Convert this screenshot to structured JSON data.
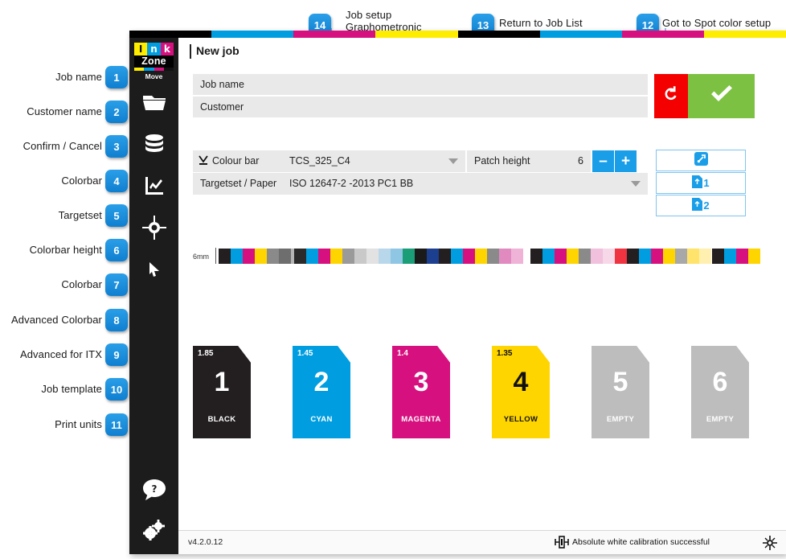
{
  "app": {
    "logo": {
      "letters": [
        "I",
        "n",
        "k"
      ],
      "word": "Zone",
      "sub": "Move"
    },
    "window_title": "New job",
    "close_label": "✖"
  },
  "form": {
    "job_name_placeholder": "Job name",
    "customer_placeholder": "Customer",
    "cancel_label": "↶",
    "confirm_label": "✔"
  },
  "options": {
    "colour_bar_label": "Colour bar",
    "colour_bar_value": "TCS_325_C4",
    "patch_height_label": "Patch height",
    "patch_height_value": "6",
    "minus_label": "–",
    "plus_label": "+",
    "targetset_label": "Targetset / Paper",
    "targetset_value": "ISO 12647-2 -2013 PC1 BB",
    "advanced_colorbar_label": "↗",
    "itx1_label": "1",
    "itx2_label": "2"
  },
  "strip": {
    "scale_label": "6mm"
  },
  "units": [
    {
      "density": "1.85",
      "number": "1",
      "name": "BLACK",
      "bg": "#231f20",
      "fg": "#ffffff"
    },
    {
      "density": "1.45",
      "number": "2",
      "name": "CYAN",
      "bg": "#009ee0",
      "fg": "#ffffff"
    },
    {
      "density": "1.4",
      "number": "3",
      "name": "MAGENTA",
      "bg": "#d6117f",
      "fg": "#ffffff"
    },
    {
      "density": "1.35",
      "number": "4",
      "name": "YELLOW",
      "bg": "#ffd500",
      "fg": "#111111"
    },
    {
      "density": "",
      "number": "5",
      "name": "EMPTY",
      "bg": "#bdbdbd",
      "fg": "#ffffff"
    },
    {
      "density": "",
      "number": "6",
      "name": "EMPTY",
      "bg": "#bdbdbd",
      "fg": "#ffffff"
    }
  ],
  "status": {
    "version": "v4.2.0.12",
    "calibration": "Absolute white calibration successful"
  },
  "sidebar": {
    "items": [
      {
        "icon": "folder-icon"
      },
      {
        "icon": "database-icon"
      },
      {
        "icon": "chart-icon"
      },
      {
        "icon": "target-icon"
      },
      {
        "icon": "cursor-icon"
      },
      {
        "icon": "help-icon"
      },
      {
        "icon": "settings-icon"
      }
    ]
  },
  "annotations": {
    "left": [
      {
        "n": "1",
        "label": "Job name"
      },
      {
        "n": "2",
        "label": "Customer name"
      },
      {
        "n": "3",
        "label": "Confirm / Cancel"
      },
      {
        "n": "4",
        "label": "Colorbar"
      },
      {
        "n": "5",
        "label": "Targetset"
      },
      {
        "n": "6",
        "label": "Colorbar height"
      },
      {
        "n": "7",
        "label": "Colorbar"
      },
      {
        "n": "8",
        "label": "Advanced Colorbar"
      },
      {
        "n": "9",
        "label": "Advanced for ITX"
      },
      {
        "n": "10",
        "label": "Job template"
      },
      {
        "n": "11",
        "label": "Print units"
      }
    ],
    "top": [
      {
        "n": "14",
        "label": "Job setup\nGraphometronic"
      },
      {
        "n": "13",
        "label": "Return to Job List"
      },
      {
        "n": "12",
        "label": "Got to Spot color setup"
      }
    ]
  },
  "colors": {
    "accent": "#1a9ee8",
    "cyan": "#009ee0",
    "magenta": "#d6117f",
    "yellow": "#ffed00",
    "black": "#000000",
    "confirm_green": "#7cc142",
    "cancel_red": "#f40000"
  },
  "cmyk_bar": [
    "#000000",
    "#009ee0",
    "#d6117f",
    "#ffed00",
    "#000000",
    "#009ee0",
    "#d6117f",
    "#ffed00"
  ],
  "strip_groups": [
    [
      "#231f20",
      "#009ee0",
      "#d6117f",
      "#ffd500",
      "#8a8a8a",
      "#6e6e6e",
      "#b5b5b5"
    ],
    [
      "#2b2b2b",
      "#009ee0",
      "#d6117f",
      "#ffd500",
      "#9a9a9a",
      "#c9c9c9",
      "#e2e2e2",
      "#b9d7ea",
      "#8fc6e4",
      "#1b9e77",
      "#1a1a1a",
      "#1d3f8f",
      "#231f20",
      "#009ee0",
      "#d6117f",
      "#ffd500",
      "#8a8a8a",
      "#e08ac0",
      "#efb3d8"
    ],
    [
      "#231f20",
      "#009ee0",
      "#d6117f",
      "#ffd500",
      "#8a8a8a",
      "#f0c0dc",
      "#f6d8e8",
      "#ef3340",
      "#231f20",
      "#009ee0",
      "#d6117f",
      "#ffd500",
      "#a8a8a8",
      "#ffe36b",
      "#fff0b0"
    ],
    [
      "#231f20",
      "#009ee0",
      "#d6117f",
      "#ffd500"
    ]
  ]
}
